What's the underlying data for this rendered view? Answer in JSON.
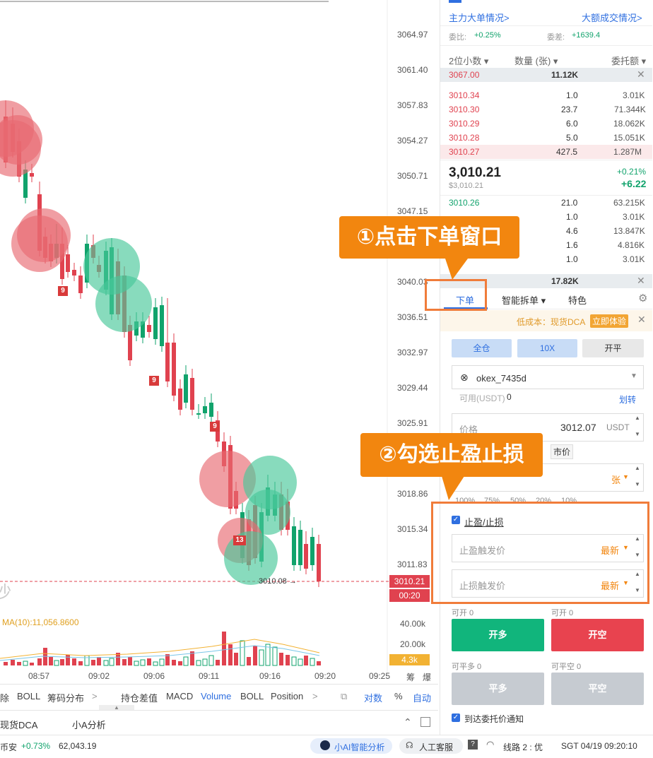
{
  "chart": {
    "y_ticks": [
      "3064.97",
      "3061.40",
      "3057.83",
      "3054.27",
      "3050.71",
      "3047.15",
      "3040.03",
      "3036.51",
      "3032.97",
      "3029.44",
      "3025.91",
      "3018.86",
      "3015.34",
      "3011.83"
    ],
    "x_ticks": [
      "08:57",
      "09:02",
      "09:06",
      "09:11",
      "09:16",
      "09:20",
      "09:25"
    ],
    "last_price_tag": "3010.21",
    "countdown_tag": "00:20",
    "price_line_label": "3010.08",
    "ma_label": "MA(10):11,056.8600",
    "vol_ticks": [
      "40.00k",
      "20.00k"
    ],
    "vol_current": "4.3k",
    "markers": [
      "9",
      "9",
      "9",
      "13"
    ],
    "partial_char": "沙",
    "right_edge_labels": [
      "筹",
      "爆"
    ]
  },
  "toolbar": {
    "items": [
      "除",
      "BOLL",
      "筹码分布",
      ">",
      "持仓差值",
      "MACD",
      "Volume",
      "BOLL",
      "Position",
      ">"
    ],
    "log": "对数",
    "pct": "%",
    "auto": "自动"
  },
  "bottom_tabs": [
    "现货DCA",
    "小A分析"
  ],
  "orderbook": {
    "link1": "主力大单情况>",
    "link2": "大额成交情况>",
    "ratio_label": "委比:",
    "ratio_value": "+0.25%",
    "diff_label": "委差:",
    "diff_value": "+1639.4",
    "col1": "2位小数",
    "col2": "数量 (张)",
    "col3": "委托额",
    "top_ask_price": "3067.00",
    "top_ask_qty": "11.12K",
    "asks": [
      {
        "p": "3010.34",
        "q": "1.0",
        "a": "3.01K"
      },
      {
        "p": "3010.30",
        "q": "23.7",
        "a": "71.344K"
      },
      {
        "p": "3010.29",
        "q": "6.0",
        "a": "18.062K"
      },
      {
        "p": "3010.28",
        "q": "5.0",
        "a": "15.051K"
      },
      {
        "p": "3010.27",
        "q": "427.5",
        "a": "1.287M"
      }
    ],
    "last_price": "3,010.21",
    "last_usd": "$3,010.21",
    "change_pct": "+0.21%",
    "change_abs": "+6.22",
    "bids": [
      {
        "p": "3010.26",
        "q": "21.0",
        "a": "63.215K"
      },
      {
        "p": "",
        "q": "1.0",
        "a": "3.01K"
      },
      {
        "p": "",
        "q": "4.6",
        "a": "13.847K"
      },
      {
        "p": "",
        "q": "1.6",
        "a": "4.816K"
      },
      {
        "p": "",
        "q": "1.0",
        "a": "3.01K"
      }
    ],
    "bottom_bid_qty": "17.82K"
  },
  "order": {
    "tab_order": "下单",
    "tab_split": "智能拆单",
    "tab_special": "特色",
    "promo_text": "低成本：现货DCA",
    "promo_btn": "立即体验",
    "mode_cross": "全仓",
    "mode_lev": "10X",
    "mode_flat": "开平",
    "account": "okex_7435d",
    "avail_label": "可用(USDT)",
    "avail_value": "0",
    "transfer": "划转",
    "price_label": "价格",
    "price_value": "3012.07",
    "price_unit": "USDT",
    "market": "市价",
    "qty_unit": "张",
    "pcts": [
      "100%",
      "75%",
      "50%",
      "20%",
      "10%"
    ],
    "tpsl_label": "止盈/止损",
    "tp_label": "止盈触发价",
    "tp_mode": "最新",
    "sl_label": "止损触发价",
    "sl_mode": "最新",
    "can_open_long": "可开 0",
    "can_open_short": "可开 0",
    "open_long": "开多",
    "open_short": "开空",
    "can_close_long": "可平多 0",
    "can_close_short": "可平空 0",
    "close_long": "平多",
    "close_short": "平空",
    "notify": "到达委托价通知"
  },
  "callouts": {
    "one": "①点击下单窗口",
    "two": "②勾选止盈止损"
  },
  "status": {
    "ticker_name": "币安",
    "ticker_change": "+0.73%",
    "ticker_price": "62,043.19",
    "ai": "小AI智能分析",
    "service": "人工客服",
    "route": "线路 2 : 优",
    "time": "SGT  04/19 09:20:10"
  },
  "colors": {
    "up": "#11a36c",
    "down": "#e0424f",
    "accent": "#2f6fe0",
    "callout": "#f2860f"
  }
}
